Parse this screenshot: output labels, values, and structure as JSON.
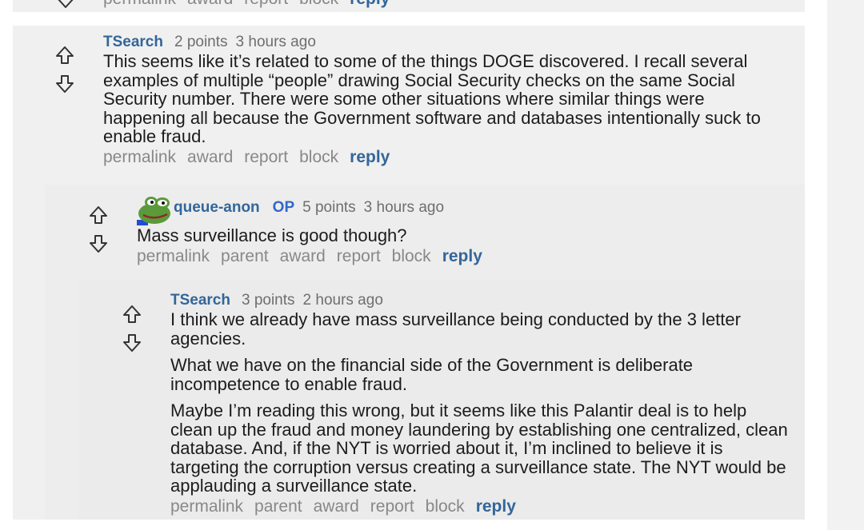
{
  "comment0": {
    "actions": [
      "permalink",
      "award",
      "report",
      "block"
    ],
    "reply": "reply"
  },
  "comment1": {
    "author": "TSearch",
    "points": "2 points",
    "time": "3 hours ago",
    "paragraphs": [
      "This seems like it’s related to some of the things DOGE discovered. I recall several examples of multiple “people” drawing Social Security checks on the same Social Security number. There were some other situations where similar things were happening all because the Government software and databases intentionally suck to enable fraud."
    ],
    "actions": [
      "permalink",
      "award",
      "report",
      "block"
    ],
    "reply": "reply"
  },
  "comment2": {
    "author": "queue-anon",
    "op_badge": "OP",
    "points": "5 points",
    "time": "3 hours ago",
    "paragraphs": [
      "Mass surveillance is good though?"
    ],
    "actions": [
      "permalink",
      "parent",
      "award",
      "report",
      "block"
    ],
    "reply": "reply"
  },
  "comment3": {
    "author": "TSearch",
    "points": "3 points",
    "time": "2 hours ago",
    "paragraphs": [
      "I think we already have mass surveillance being conducted by the 3 letter agencies.",
      "What we have on the financial side of the Government is deliberate incompetence to enable fraud.",
      "Maybe I’m reading this wrong, but it seems like this Palantir deal is to help clean up the fraud and money laundering by establishing one centralized, clean database. And, if the NYT is worried about it, I’m inclined to believe it is targeting the corruption versus creating a surveillance state. The NYT would be applauding a surveillance state."
    ],
    "actions": [
      "permalink",
      "parent",
      "award",
      "report",
      "block"
    ],
    "reply": "reply"
  },
  "icons": {
    "upvote": "arrow-up-outline-icon",
    "downvote": "arrow-down-outline-icon",
    "avatar": "frog-avatar-icon"
  },
  "colors": {
    "author": "#336699",
    "op": "#3366cc",
    "muted": "#888888",
    "card": "#f0f0f0"
  }
}
